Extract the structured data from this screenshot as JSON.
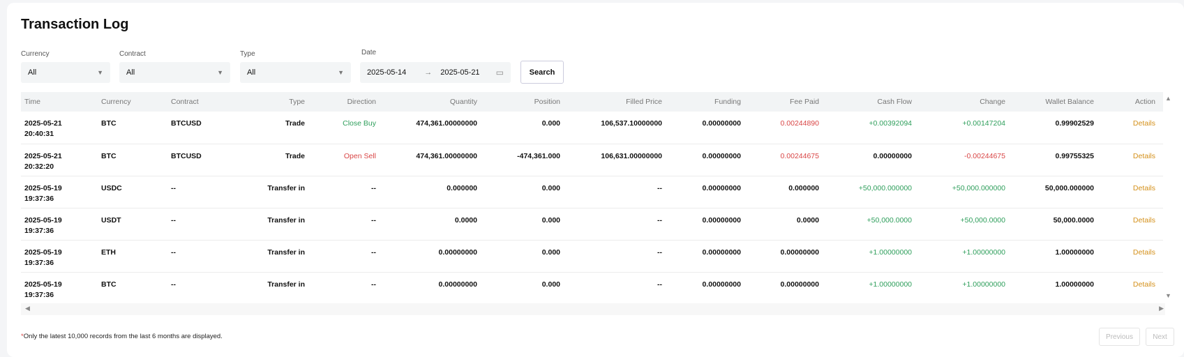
{
  "page": {
    "title": "Transaction Log"
  },
  "filters": {
    "currency": {
      "label": "Currency",
      "value": "All"
    },
    "contract": {
      "label": "Contract",
      "value": "All"
    },
    "type": {
      "label": "Type",
      "value": "All"
    },
    "date": {
      "label": "Date",
      "start": "2025-05-14",
      "end": "2025-05-21"
    },
    "search_label": "Search"
  },
  "table": {
    "headers": [
      "Time",
      "Currency",
      "Contract",
      "Type",
      "Direction",
      "Quantity",
      "Position",
      "Filled Price",
      "Funding",
      "Fee Paid",
      "Cash Flow",
      "Change",
      "Wallet Balance",
      "Action"
    ],
    "rows": [
      {
        "date": "2025-05-21",
        "time": "20:40:31",
        "currency": "BTC",
        "contract": "BTCUSD",
        "type": "Trade",
        "direction": "Close Buy",
        "quantity": "474,361.00000000",
        "position": "0.000",
        "filled_price": "106,537.10000000",
        "funding": "0.00000000",
        "fee_paid": "0.00244890",
        "cash_flow": "+0.00392094",
        "change": "+0.00147204",
        "wallet_balance": "0.99902529",
        "action": "Details"
      },
      {
        "date": "2025-05-21",
        "time": "20:32:20",
        "currency": "BTC",
        "contract": "BTCUSD",
        "type": "Trade",
        "direction": "Open Sell",
        "quantity": "474,361.00000000",
        "position": "-474,361.000",
        "filled_price": "106,631.00000000",
        "funding": "0.00000000",
        "fee_paid": "0.00244675",
        "cash_flow": "0.00000000",
        "change": "-0.00244675",
        "wallet_balance": "0.99755325",
        "action": "Details"
      },
      {
        "date": "2025-05-19",
        "time": "19:37:36",
        "currency": "USDC",
        "contract": "--",
        "type": "Transfer in",
        "direction": "--",
        "quantity": "0.000000",
        "position": "0.000",
        "filled_price": "--",
        "funding": "0.00000000",
        "fee_paid": "0.000000",
        "cash_flow": "+50,000.000000",
        "change": "+50,000.000000",
        "wallet_balance": "50,000.000000",
        "action": "Details"
      },
      {
        "date": "2025-05-19",
        "time": "19:37:36",
        "currency": "USDT",
        "contract": "--",
        "type": "Transfer in",
        "direction": "--",
        "quantity": "0.0000",
        "position": "0.000",
        "filled_price": "--",
        "funding": "0.00000000",
        "fee_paid": "0.0000",
        "cash_flow": "+50,000.0000",
        "change": "+50,000.0000",
        "wallet_balance": "50,000.0000",
        "action": "Details"
      },
      {
        "date": "2025-05-19",
        "time": "19:37:36",
        "currency": "ETH",
        "contract": "--",
        "type": "Transfer in",
        "direction": "--",
        "quantity": "0.00000000",
        "position": "0.000",
        "filled_price": "--",
        "funding": "0.00000000",
        "fee_paid": "0.00000000",
        "cash_flow": "+1.00000000",
        "change": "+1.00000000",
        "wallet_balance": "1.00000000",
        "action": "Details"
      },
      {
        "date": "2025-05-19",
        "time": "19:37:36",
        "currency": "BTC",
        "contract": "--",
        "type": "Transfer in",
        "direction": "--",
        "quantity": "0.00000000",
        "position": "0.000",
        "filled_price": "--",
        "funding": "0.00000000",
        "fee_paid": "0.00000000",
        "cash_flow": "+1.00000000",
        "change": "+1.00000000",
        "wallet_balance": "1.00000000",
        "action": "Details"
      }
    ]
  },
  "footer": {
    "asterisk": "*",
    "note": "Only the latest 10,000 records from the last 6 months are displayed.",
    "previous_label": "Previous",
    "next_label": "Next"
  },
  "colors": {
    "positive": "#2e9e5b",
    "negative": "#d94545",
    "action": "#d4901a"
  }
}
